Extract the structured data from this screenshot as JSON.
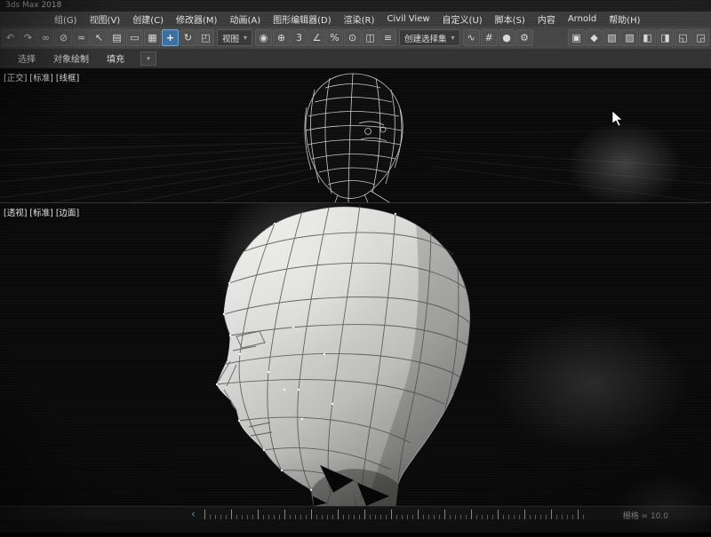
{
  "window": {
    "title": "3ds Max 2018"
  },
  "menubar": {
    "items": [
      "组(G)",
      "视图(V)",
      "创建(C)",
      "修改器(M)",
      "动画(A)",
      "图形编辑器(D)",
      "渲染(R)",
      "Civil View",
      "自定义(U)",
      "脚本(S)",
      "内容",
      "Arnold",
      "帮助(H)"
    ]
  },
  "toolbar": {
    "icons": [
      {
        "g": "↶"
      },
      {
        "g": "↷"
      },
      {
        "g": "∞"
      },
      {
        "g": "⊘"
      },
      {
        "g": "≈"
      },
      {
        "g": "↖"
      },
      {
        "g": "▤"
      },
      {
        "g": "▭"
      },
      {
        "g": "▦"
      },
      {
        "g": "+"
      },
      {
        "g": "↻"
      },
      {
        "g": "◰"
      },
      {
        "g": "◉"
      },
      {
        "g": "⊕"
      },
      {
        "g": "3"
      },
      {
        "g": "∠"
      },
      {
        "g": "%"
      },
      {
        "g": "⊙"
      },
      {
        "g": "◫"
      },
      {
        "g": "≡"
      },
      {
        "g": "∿"
      },
      {
        "g": "#"
      },
      {
        "g": "●"
      },
      {
        "g": "⚙"
      },
      {
        "g": "▣"
      },
      {
        "g": "◆"
      },
      {
        "g": "▧"
      },
      {
        "g": "▨"
      },
      {
        "g": "◧"
      },
      {
        "g": "◨"
      },
      {
        "g": "◱"
      },
      {
        "g": "◲"
      }
    ],
    "view_reference": "视图",
    "selection_set_placeholder": "创建选择集",
    "dropdown_arrow": "▾"
  },
  "ribbon": {
    "tabs": [
      "选择",
      "对象绘制",
      "填充"
    ],
    "more_arrow": "▾"
  },
  "viewport_top": {
    "labels": [
      "[正交]",
      "[标准]",
      "[线框]"
    ]
  },
  "viewport_bottom": {
    "labels": [
      "[透视]",
      "[标准]",
      "[边面]"
    ]
  },
  "statusbar": {
    "grid_readout": "栅格 = 10.0",
    "time_marker": "‹"
  },
  "colors": {
    "active_tool_highlight": "#3d6f9e",
    "time_marker": "#3fc6cc",
    "ui_background": "#454545"
  }
}
